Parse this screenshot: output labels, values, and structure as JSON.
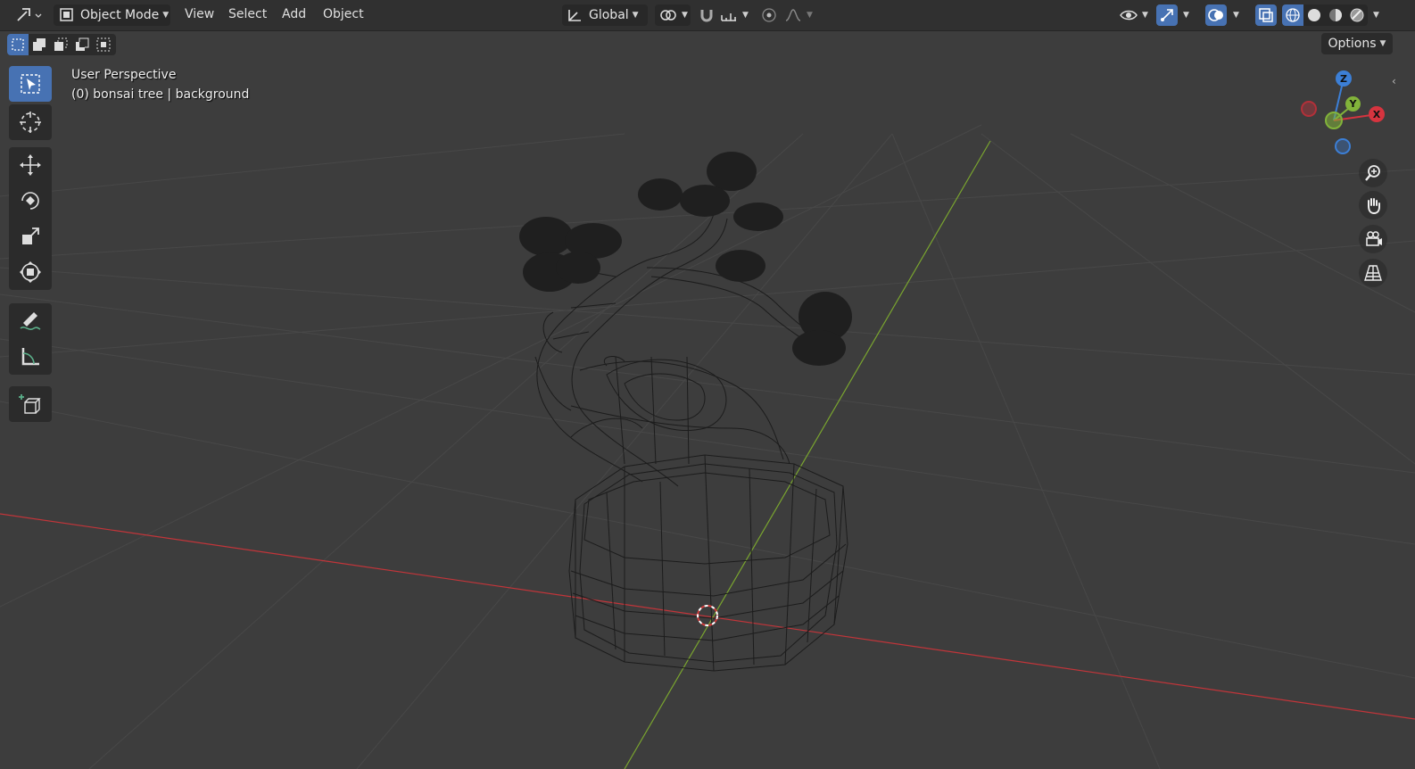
{
  "header": {
    "editor_type_icon": "editor-type-icon",
    "mode": {
      "label": "Object Mode",
      "icon": "object-mode-icon"
    },
    "menu": [
      {
        "label": "View"
      },
      {
        "label": "Select"
      },
      {
        "label": "Add"
      },
      {
        "label": "Object"
      }
    ],
    "transform_orientation": {
      "label": "Global",
      "icon": "orientation-icon"
    },
    "pivot_icon": "pivot-point-icon",
    "snap_icon": "snap-magnet-icon",
    "snap_target_icon": "snap-increment-icon",
    "proportional_icon": "proportional-editing-icon",
    "falloff_icon": "falloff-curve-icon",
    "right_tools": {
      "visibility_icon": "eye-icon",
      "gizmo_icon": "gizmo-icon",
      "overlay_icon": "overlay-icon",
      "xray_icon": "xray-icon",
      "shading": [
        "wireframe-shading-icon",
        "solid-shading-icon",
        "material-shading-icon",
        "rendered-shading-icon"
      ]
    }
  },
  "select_modes": [
    "select-new-icon",
    "select-extend-icon",
    "select-subtract-icon",
    "select-invert-icon",
    "select-intersect-icon"
  ],
  "options": {
    "label": "Options"
  },
  "toolbar": [
    "select-box-icon",
    "cursor-icon",
    "move-icon",
    "rotate-icon",
    "scale-icon",
    "transform-icon",
    "annotate-icon",
    "measure-icon",
    "add-cube-icon"
  ],
  "viewport": {
    "perspective_label": "User Perspective",
    "object_label": "(0) bonsai tree | background"
  },
  "gizmo": {
    "z": "Z",
    "y": "Y",
    "x": "X"
  },
  "nav_buttons": [
    "zoom-icon",
    "pan-hand-icon",
    "camera-view-icon",
    "grid-ortho-icon"
  ],
  "colors": {
    "background": "#3d3d3d",
    "header": "#303030",
    "accent_blue": "#4772b3",
    "x_axis": "#d6343f",
    "y_axis": "#82b33a",
    "z_axis": "#3c7fd6",
    "grid": "#4a4a4a"
  }
}
